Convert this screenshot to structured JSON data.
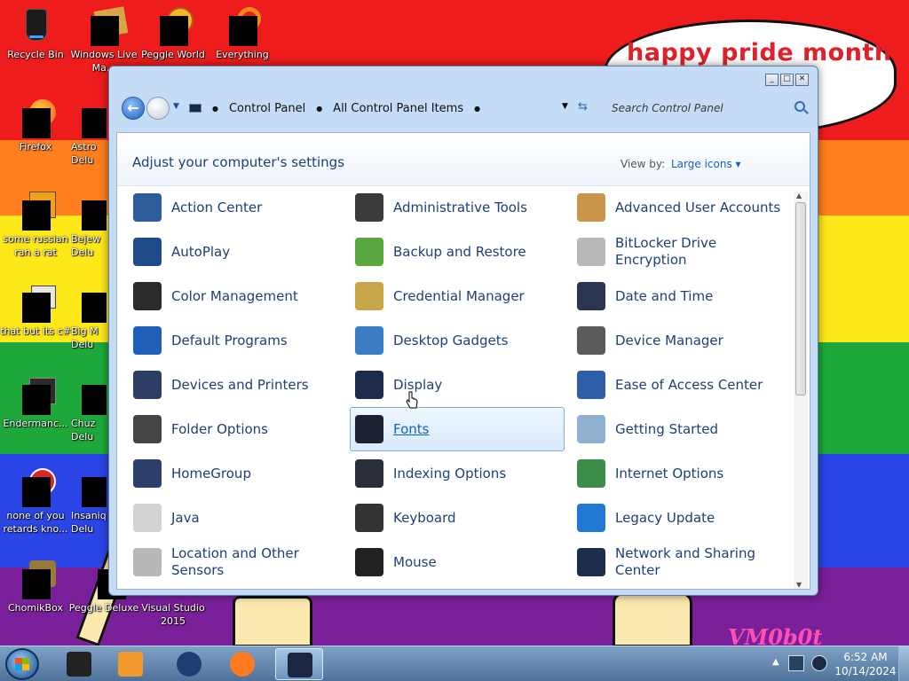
{
  "desktop": {
    "bubble_text": "happy pride month",
    "signature": "VM0b0t",
    "icons": [
      {
        "name": "recycle-bin-icon",
        "label": "Recycle Bin"
      },
      {
        "name": "windows-live-movie-maker-icon",
        "label": "Windows Live Ma..."
      },
      {
        "name": "peggle-world-icon",
        "label": "Peggle World"
      },
      {
        "name": "everything-icon",
        "label": "Everything"
      },
      {
        "name": "firefox-icon",
        "label": "Firefox"
      },
      {
        "name": "astropop-deluxe-icon",
        "label": "Astro Delu"
      },
      {
        "name": "some-russian-ran-a-rat-icon",
        "label": "some russian ran a rat"
      },
      {
        "name": "bejeweled-deluxe-icon",
        "label": "Bejew Delu"
      },
      {
        "name": "that-but-its-cs-icon",
        "label": "that but its c#"
      },
      {
        "name": "big-money-deluxe-icon",
        "label": "Big M Delu"
      },
      {
        "name": "endermanch-icon",
        "label": "Endermanc..."
      },
      {
        "name": "chuzzle-deluxe-icon",
        "label": "Chuz Delu"
      },
      {
        "name": "none-of-you-icon",
        "label": "none of you retards kno..."
      },
      {
        "name": "insaniquarium-deluxe-icon",
        "label": "Insaniq Delu"
      },
      {
        "name": "chomikbox-icon",
        "label": "ChomikBox"
      },
      {
        "name": "peggle-deluxe-icon",
        "label": "Peggle Deluxe"
      },
      {
        "name": "visual-studio-2015-icon",
        "label": "Visual Studio 2015"
      }
    ]
  },
  "window": {
    "breadcrumb": [
      "Control Panel",
      "All Control Panel Items"
    ],
    "search_placeholder": "Search Control Panel",
    "heading": "Adjust your computer's settings",
    "view_by_label": "View by:",
    "view_by_value": "Large icons",
    "items": [
      {
        "label": "Action Center",
        "icon": "shield-flag-icon",
        "color": "#2f5c9a"
      },
      {
        "label": "Administrative Tools",
        "icon": "admin-tools-icon",
        "color": "#3a3a3a"
      },
      {
        "label": "Advanced User Accounts",
        "icon": "users-icon",
        "color": "#c9954a"
      },
      {
        "label": "AutoPlay",
        "icon": "autoplay-icon",
        "color": "#1f4b8a"
      },
      {
        "label": "Backup and Restore",
        "icon": "backup-icon",
        "color": "#5aa840"
      },
      {
        "label": "BitLocker Drive Encryption",
        "icon": "key-icon",
        "color": "#b9b9b9"
      },
      {
        "label": "Color Management",
        "icon": "monitor-icon",
        "color": "#2a2a2a"
      },
      {
        "label": "Credential Manager",
        "icon": "vault-icon",
        "color": "#c8a64a"
      },
      {
        "label": "Date and Time",
        "icon": "calendar-clock-icon",
        "color": "#2a3550"
      },
      {
        "label": "Default Programs",
        "icon": "default-programs-icon",
        "color": "#1f5fb8"
      },
      {
        "label": "Desktop Gadgets",
        "icon": "gadgets-icon",
        "color": "#3b7ec7"
      },
      {
        "label": "Device Manager",
        "icon": "device-manager-icon",
        "color": "#5a5a5a"
      },
      {
        "label": "Devices and Printers",
        "icon": "printer-icon",
        "color": "#2c3e66"
      },
      {
        "label": "Display",
        "icon": "display-icon",
        "color": "#1d2b4a"
      },
      {
        "label": "Ease of Access Center",
        "icon": "ease-of-access-icon",
        "color": "#2e5ea8"
      },
      {
        "label": "Folder Options",
        "icon": "folder-options-icon",
        "color": "#444"
      },
      {
        "label": "Fonts",
        "icon": "fonts-icon",
        "color": "#1c2233"
      },
      {
        "label": "Getting Started",
        "icon": "getting-started-icon",
        "color": "#8fb0cf"
      },
      {
        "label": "HomeGroup",
        "icon": "homegroup-icon",
        "color": "#2b3f6b"
      },
      {
        "label": "Indexing Options",
        "icon": "indexing-icon",
        "color": "#2a2f3a"
      },
      {
        "label": "Internet Options",
        "icon": "internet-options-icon",
        "color": "#3d8d4a"
      },
      {
        "label": "Java",
        "icon": "java-icon",
        "color": "#d2d2d2"
      },
      {
        "label": "Keyboard",
        "icon": "keyboard-icon",
        "color": "#333"
      },
      {
        "label": "Legacy Update",
        "icon": "legacy-update-icon",
        "color": "#1f78d1"
      },
      {
        "label": "Location and Other Sensors",
        "icon": "location-icon",
        "color": "#b8b8b8"
      },
      {
        "label": "Mouse",
        "icon": "mouse-icon",
        "color": "#222"
      },
      {
        "label": "Network and Sharing Center",
        "icon": "network-icon",
        "color": "#1d2c48"
      }
    ]
  },
  "taskbar": {
    "items": [
      {
        "name": "taskbar-app-1-icon",
        "color": "#222"
      },
      {
        "name": "taskbar-media-player-icon",
        "color": "#f29a2e"
      },
      {
        "name": "taskbar-globe-icon",
        "color": "#1c3e70"
      },
      {
        "name": "taskbar-firefox-icon",
        "color": "#ff7b1f"
      },
      {
        "name": "taskbar-control-panel-icon",
        "color": "#1c2640"
      }
    ],
    "clock_time": "6:52 AM",
    "clock_date": "10/14/2024"
  }
}
